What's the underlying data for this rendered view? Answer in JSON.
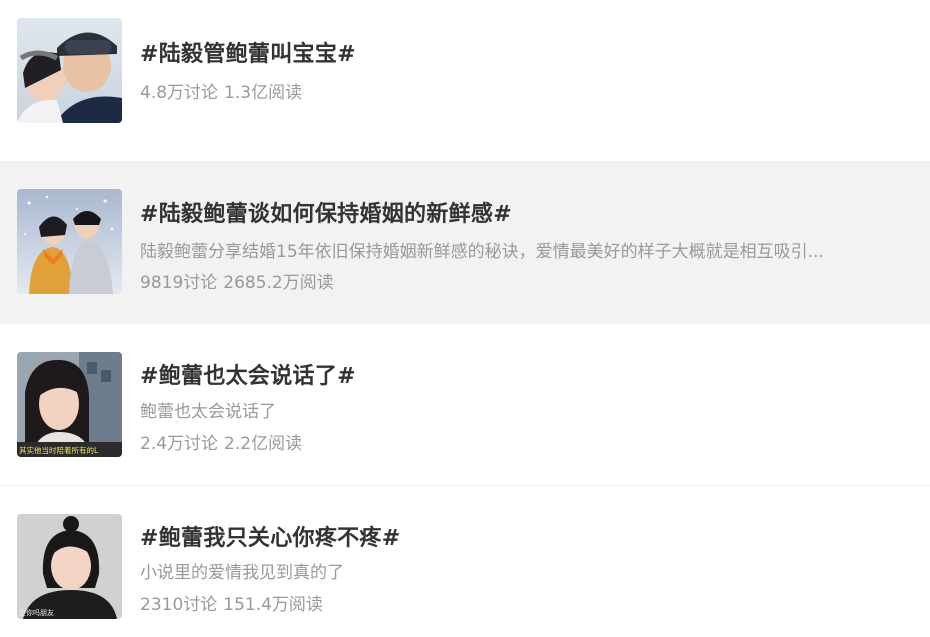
{
  "topics": [
    {
      "title": "#陆毅管鲍蕾叫宝宝#",
      "desc": "",
      "discuss": "4.8万讨论",
      "read": "1.3亿阅读",
      "thumb_icon": "ski-couple-photo"
    },
    {
      "title": "#陆毅鲍蕾谈如何保持婚姻的新鲜感#",
      "desc": "陆毅鲍蕾分享结婚15年依旧保持婚姻新鲜感的秘诀，爱情最美好的样子大概就是相互吸引...",
      "discuss": "9819讨论",
      "read": "2685.2万阅读",
      "thumb_icon": "snow-couple-photo"
    },
    {
      "title": "#鲍蕾也太会说话了#",
      "desc": "鲍蕾也太会说话了",
      "discuss": "2.4万讨论",
      "read": "2.2亿阅读",
      "thumb_icon": "woman-portrait-photo",
      "thumb_caption": "其实他当时陪着所有的L"
    },
    {
      "title": "#鲍蕾我只关心你疼不疼#",
      "desc": "小说里的爱情我见到真的了",
      "discuss": "2310讨论",
      "read": "151.4万阅读",
      "thumb_icon": "woman-bun-photo",
      "thumb_caption": "是你吗朋友"
    }
  ],
  "colors": {
    "title": "#333333",
    "meta": "#999999",
    "highlight_row": "#f2f2f2"
  }
}
